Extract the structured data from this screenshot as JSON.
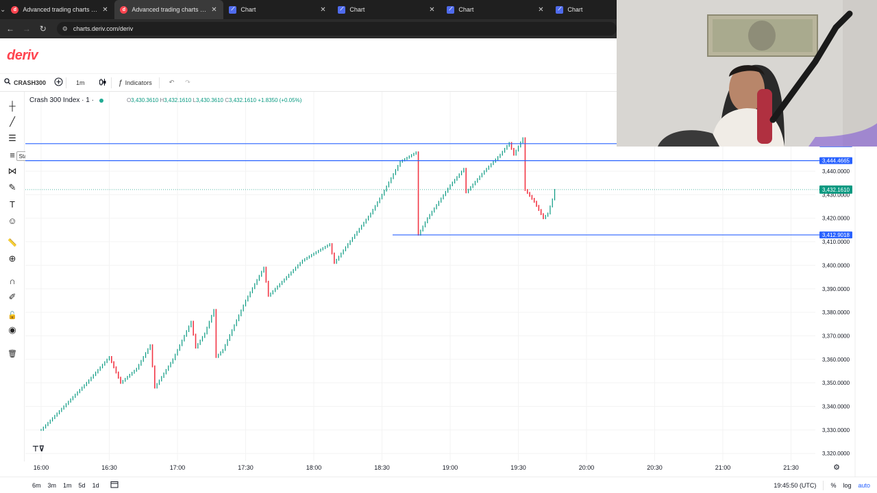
{
  "browser": {
    "tabs": [
      {
        "label": "Advanced trading charts & tools",
        "icon": "deriv-favicon",
        "active": false
      },
      {
        "label": "Advanced trading charts & tools",
        "icon": "deriv-favicon",
        "active": true
      },
      {
        "label": "Chart",
        "icon": "chart-favicon",
        "active": false
      },
      {
        "label": "Chart",
        "icon": "chart-favicon",
        "active": false
      },
      {
        "label": "Chart",
        "icon": "chart-favicon",
        "active": false
      },
      {
        "label": "Chart",
        "icon": "chart-favicon",
        "active": false
      }
    ],
    "url": "charts.deriv.com/deriv"
  },
  "app": {
    "logo": "deriv",
    "brand_color": "#ff444f"
  },
  "toolbar": {
    "symbol": "CRASH300",
    "interval": "1m",
    "indicators_label": "Indicators"
  },
  "legend": {
    "title": "Crash 300 Index · 1 ·",
    "open_label": "O",
    "open": "3,430.3610",
    "high_label": "H",
    "high": "3,432.1610",
    "low_label": "L",
    "low": "3,430.3610",
    "close_label": "C",
    "close": "3,432.1610",
    "change": "+1.8350 (+0.05%)"
  },
  "left_tools": {
    "start_label": "Start",
    "icons": [
      "crosshair-icon",
      "trend-line-icon",
      "horizontal-lines-icon",
      "fib-icon",
      "pattern-icon",
      "brush-icon",
      "text-icon",
      "emoji-icon",
      "ruler-icon",
      "zoom-in-icon",
      "magnet-icon",
      "pencil-lock-icon",
      "lock-icon",
      "eye-icon",
      "trash-icon"
    ]
  },
  "bottom": {
    "ranges": [
      "6m",
      "3m",
      "1m",
      "5d",
      "1d"
    ],
    "clock": "19:45:50 (UTC)",
    "percent_label": "%",
    "log_label": "log",
    "auto_label": "auto"
  },
  "chart_data": {
    "type": "candlestick",
    "symbol": "Crash 300 Index",
    "up_color": "#089981",
    "down_color": "#f23645",
    "x_ticks": [
      "16:00",
      "16:30",
      "17:00",
      "17:30",
      "18:00",
      "18:30",
      "19:00",
      "19:30",
      "20:00",
      "20:30",
      "21:00",
      "21:30"
    ],
    "y_ticks": [
      "3,440.0000",
      "3,430.0000",
      "3,420.0000",
      "3,410.0000",
      "3,400.0000",
      "3,390.0000",
      "3,380.0000",
      "3,370.0000",
      "3,360.0000",
      "3,350.0000",
      "3,340.0000",
      "3,330.0000",
      "3,320.0000"
    ],
    "y_tick_values": [
      3440,
      3430,
      3420,
      3410,
      3400,
      3390,
      3380,
      3370,
      3360,
      3350,
      3340,
      3330,
      3320
    ],
    "ylim": [
      3314.5,
      3453
    ],
    "price_lines": [
      {
        "label": "3,451.7248",
        "value": 3451.7,
        "color": "#2962ff"
      },
      {
        "label": "3,444.4665",
        "value": 3444.4665,
        "color": "#2962ff"
      },
      {
        "label": "3,412.9018",
        "value": 3412.9018,
        "color": "#2962ff"
      }
    ],
    "current_price": {
      "label": "3,432.1610",
      "value": 3432.161,
      "color": "#089981"
    },
    "path_points": [
      [
        "16:00",
        3330
      ],
      [
        "16:10",
        3340
      ],
      [
        "16:20",
        3350
      ],
      [
        "16:30",
        3361
      ],
      [
        "16:35",
        3350
      ],
      [
        "16:42",
        3356
      ],
      [
        "16:48",
        3366
      ],
      [
        "16:50",
        3348
      ],
      [
        "16:52",
        3351
      ],
      [
        "16:58",
        3360
      ],
      [
        "17:06",
        3376
      ],
      [
        "17:08",
        3365
      ],
      [
        "17:12",
        3371
      ],
      [
        "17:16",
        3381
      ],
      [
        "17:17",
        3361
      ],
      [
        "17:20",
        3364
      ],
      [
        "17:30",
        3385
      ],
      [
        "17:38",
        3399
      ],
      [
        "17:40",
        3387
      ],
      [
        "17:45",
        3392
      ],
      [
        "17:55",
        3402
      ],
      [
        "18:00",
        3405
      ],
      [
        "18:07",
        3409
      ],
      [
        "18:09",
        3401
      ],
      [
        "18:15",
        3409
      ],
      [
        "18:25",
        3422
      ],
      [
        "18:30",
        3430
      ],
      [
        "18:38",
        3444
      ],
      [
        "18:45",
        3448
      ],
      [
        "18:46",
        3413
      ],
      [
        "18:50",
        3420
      ],
      [
        "19:00",
        3434
      ],
      [
        "19:06",
        3441
      ],
      [
        "19:07",
        3431
      ],
      [
        "19:15",
        3440
      ],
      [
        "19:22",
        3447
      ],
      [
        "19:26",
        3452
      ],
      [
        "19:28",
        3447
      ],
      [
        "19:32",
        3454
      ],
      [
        "19:33",
        3432
      ],
      [
        "19:37",
        3427
      ],
      [
        "19:41",
        3420
      ],
      [
        "19:43",
        3422
      ],
      [
        "19:45",
        3428
      ],
      [
        "19:46",
        3432
      ]
    ]
  }
}
